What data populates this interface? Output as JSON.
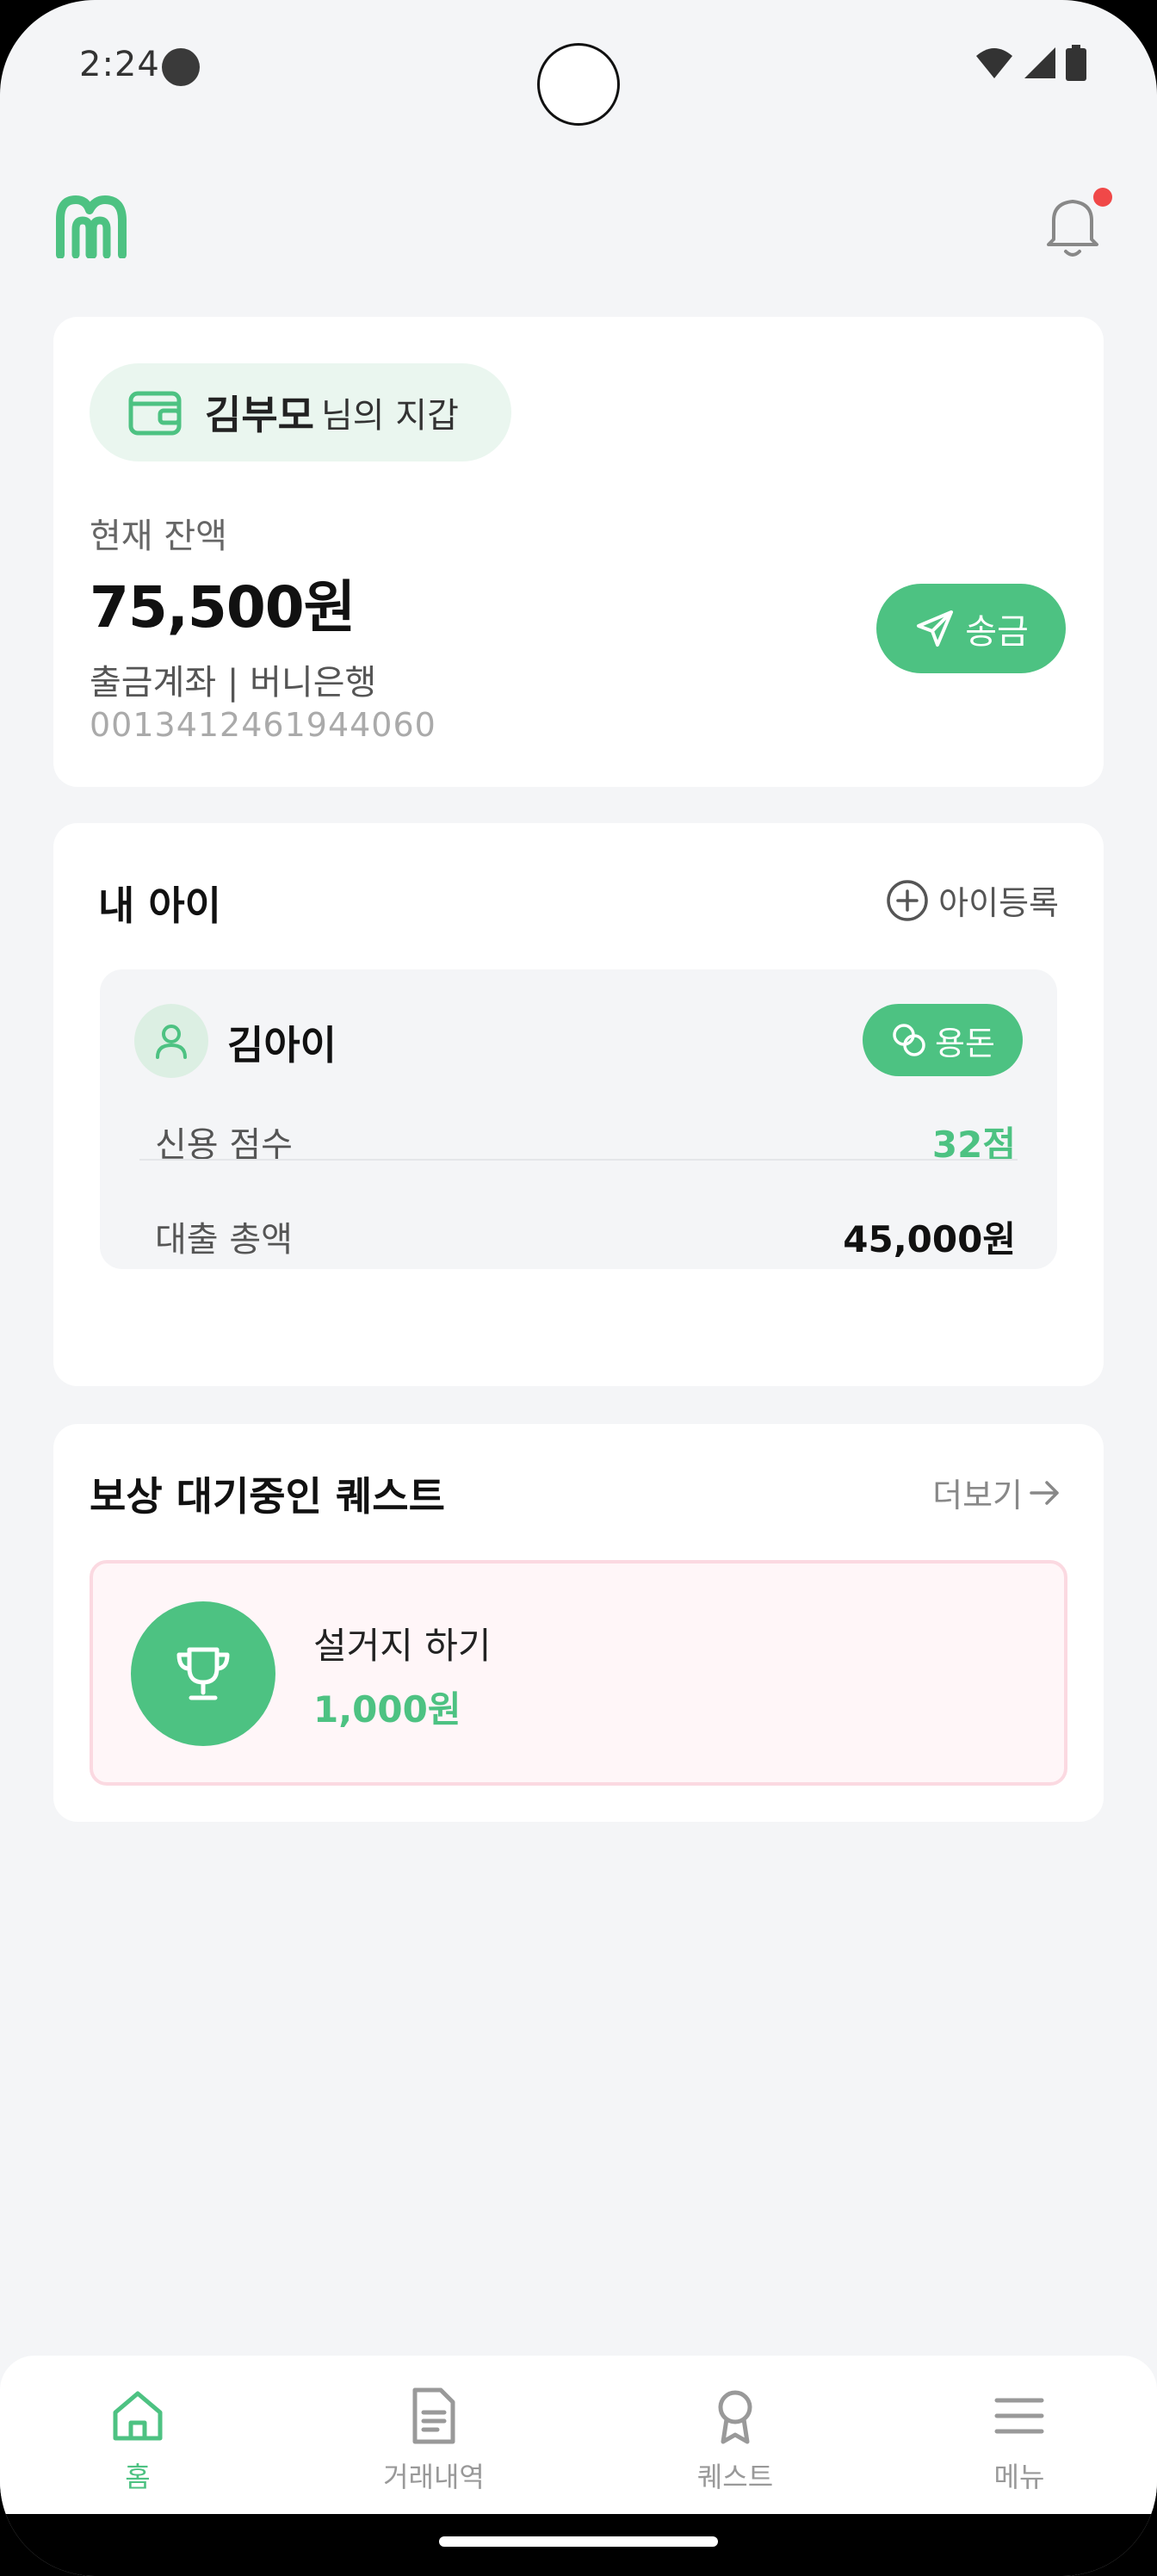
{
  "status_bar": {
    "time": "2:24"
  },
  "colors": {
    "accent": "#4dc282",
    "notification_dot": "#f04848",
    "quest_bg": "#fff6f8",
    "quest_border": "#fbd9e1"
  },
  "header": {
    "logo_icon": "app-logo-icon",
    "bell_icon": "bell-icon",
    "has_notification": true
  },
  "wallet": {
    "owner_name": "김부모",
    "owner_suffix": "님의 지갑",
    "balance_label": "현재 잔액",
    "balance": "75,500원",
    "account_label": "출금계좌 | 버니은행",
    "account_number": "0013412461944060",
    "send_label": "송금"
  },
  "kids": {
    "title": "내 아이",
    "add_label": "아이등록",
    "child": {
      "name": "김아이",
      "allowance_label": "용돈",
      "credit_label": "신용 점수",
      "credit_value": "32점",
      "loan_label": "대출 총액",
      "loan_value": "45,000원"
    }
  },
  "quests": {
    "title": "보상 대기중인 퀘스트",
    "more_label": "더보기",
    "items": [
      {
        "name": "설거지 하기",
        "reward": "1,000원",
        "icon": "trophy-icon"
      }
    ]
  },
  "nav": {
    "items": [
      {
        "label": "홈",
        "icon": "home-icon",
        "active": true
      },
      {
        "label": "거래내역",
        "icon": "document-icon",
        "active": false
      },
      {
        "label": "퀘스트",
        "icon": "award-icon",
        "active": false
      },
      {
        "label": "메뉴",
        "icon": "menu-icon",
        "active": false
      }
    ]
  }
}
